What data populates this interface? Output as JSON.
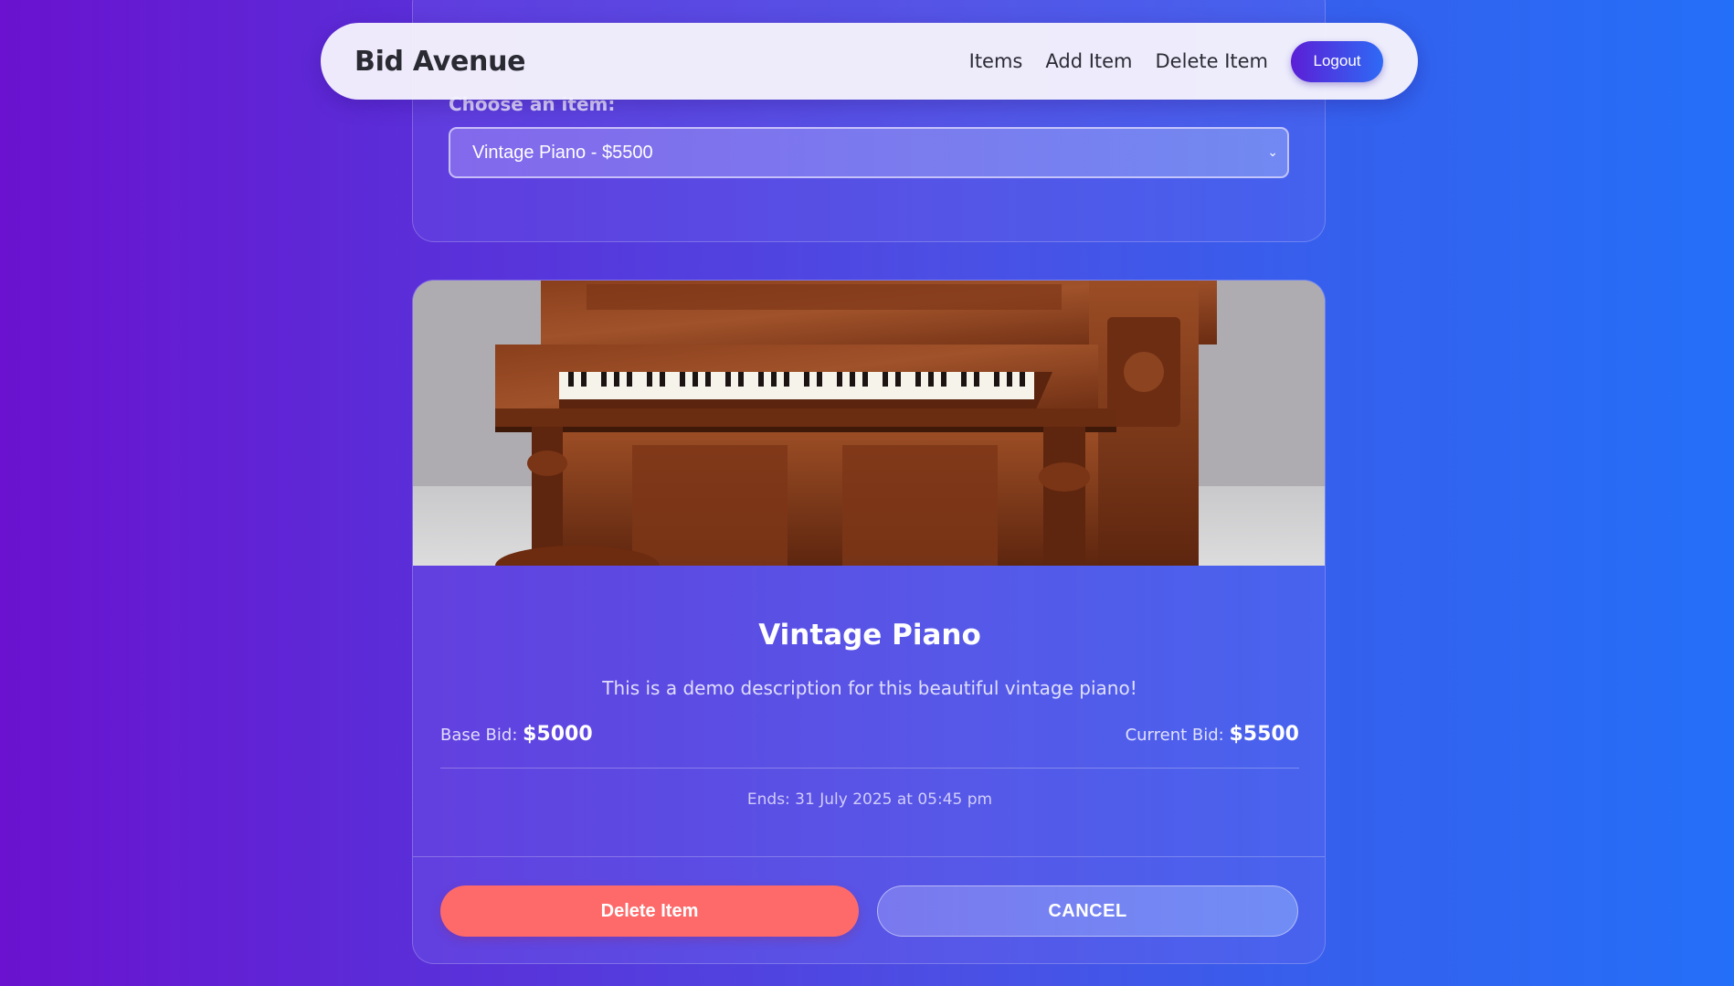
{
  "navbar": {
    "brand": "Bid Avenue",
    "links": [
      "Items",
      "Add Item",
      "Delete Item"
    ],
    "logout_label": "Logout"
  },
  "select": {
    "label": "Choose an item:",
    "selected_value": "Vintage Piano - $5500"
  },
  "item": {
    "image_icon": "piano-photo",
    "title": "Vintage Piano",
    "description": "This is a demo description for this beautiful vintage piano!",
    "base_bid_label": "Base Bid:",
    "base_bid_value": "$5000",
    "current_bid_label": "Current Bid:",
    "current_bid_value": "$5500",
    "ends_text": "Ends: 31 July 2025 at 05:45 pm"
  },
  "actions": {
    "delete_label": "Delete Item",
    "cancel_label": "CANCEL"
  },
  "colors": {
    "delete_button": "#fe6a6a",
    "gradient_start": "#6a12cf",
    "gradient_end": "#246ff8"
  }
}
